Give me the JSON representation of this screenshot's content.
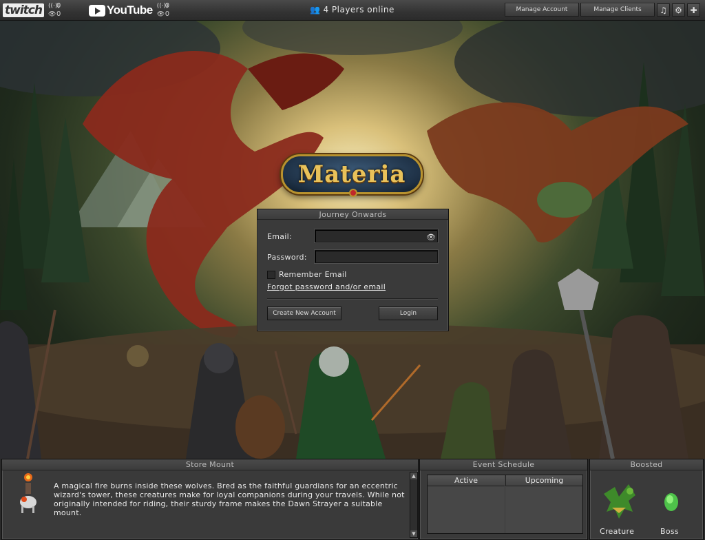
{
  "topbar": {
    "twitch": {
      "logo": "twitch",
      "viewers": "0",
      "watchers": "0"
    },
    "youtube": {
      "logo": "YouTube",
      "viewers": "0",
      "watchers": "0"
    },
    "players_online": "4 Players online",
    "manage_account": "Manage Account",
    "manage_clients": "Manage Clients",
    "icons": [
      "music-icon",
      "gear-icon",
      "puzzle-icon"
    ]
  },
  "logo": {
    "text": "Materia"
  },
  "login": {
    "title": "Journey Onwards",
    "email_label": "Email:",
    "email_value": "",
    "password_label": "Password:",
    "password_value": "",
    "remember_label": "Remember Email",
    "remember_checked": false,
    "forgot_link": "Forgot password and/or email",
    "create_button": "Create New Account",
    "login_button": "Login"
  },
  "store": {
    "title": "Store Mount",
    "description": "A magical fire burns inside these wolves. Bred as the faithful guardians for an eccentric wizard's tower, these creatures make for loyal companions during your travels. While not originally intended for riding, their sturdy frame makes the Dawn Strayer a suitable mount."
  },
  "events": {
    "title": "Event Schedule",
    "columns": [
      "Active",
      "Upcoming"
    ]
  },
  "boosted": {
    "title": "Boosted",
    "creature_label": "Creature",
    "boss_label": "Boss"
  },
  "colors": {
    "panel": "#3a3a3a",
    "topbar": "#3a3a3a",
    "accent_gold": "#e9c25a"
  }
}
